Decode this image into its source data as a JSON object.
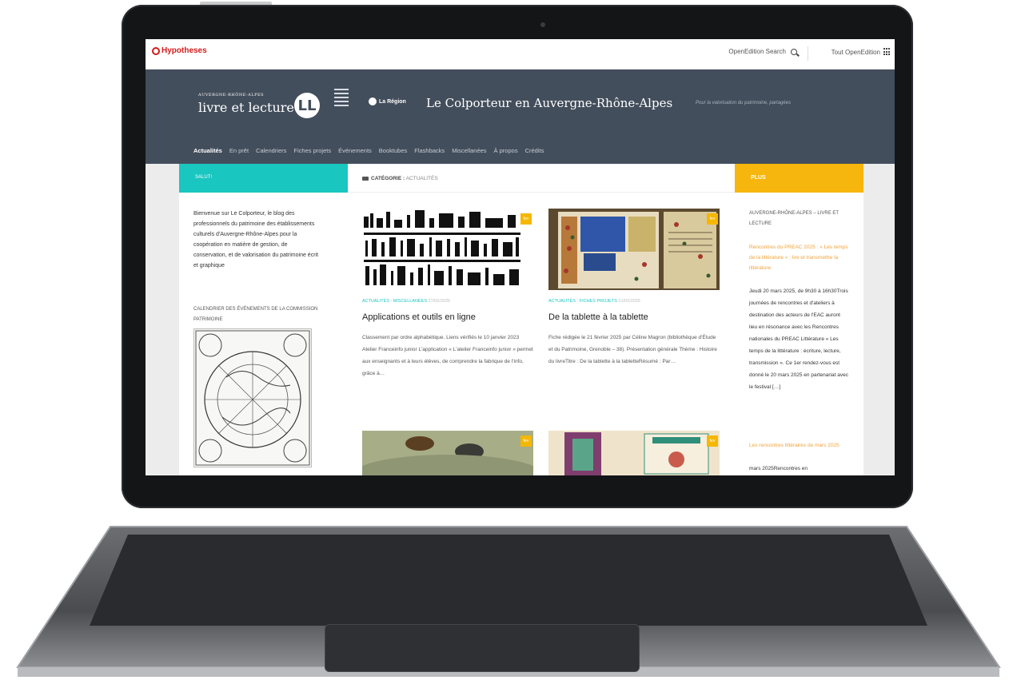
{
  "topbar": {
    "logo_text": "Hypotheses",
    "search_label": "OpenEdition Search",
    "all_label": "Tout OpenEdition"
  },
  "header": {
    "brand_small": "AUVERGNE-RHÔNE-ALPES",
    "brand_big": "livre et lecture",
    "brand_mark": "LL",
    "region_label": "La Région",
    "site_title": "Le Colporteur en Auvergne-Rhône-Alpes",
    "tagline": "Pour la valorisation du patrimoine, partagées"
  },
  "nav": {
    "items": [
      "Actualités",
      "En prêt",
      "Calendriers",
      "Fiches projets",
      "Événements",
      "Booktubes",
      "Flashbacks",
      "Miscellanées",
      "À propos",
      "Crédits"
    ],
    "active": "Actualités"
  },
  "left": {
    "bar_label": "SALUT!",
    "welcome": "Bienvenue sur Le Colporteur, le blog des professionnels du patrimoine des établissements culturels d'Auvergne-Rhône-Alpes pour la coopération en matière de gestion, de conservation, et de valorisation du patrimoine écrit et graphique",
    "calendar_heading": "CALENDRIER DES ÉVÉNEMENTS DE LA COMMISSION PATRIMOINE"
  },
  "main": {
    "category_prefix": "CATÉGORIE :",
    "category": "ACTUALITÉS",
    "posts": [
      {
        "meta": "ACTUALITÉS · MISCELLANÉES",
        "date": "27/02/2025",
        "title": "Applications et outils en ligne",
        "excerpt": "Classement par ordre alphabétique. Liens vérifiés le 10 janvier 2023 Atelier Franceinfo junior L'application « L'atelier Franceinfo junior » permet aux enseignants et à leurs élèves, de comprendre la fabrique de l'info, grâce à…",
        "badge": "fev"
      },
      {
        "meta": "ACTUALITÉS · FICHES PROJETS",
        "date": "21/02/2025",
        "title": "De la tablette à la tablette",
        "excerpt": "Fiche rédigée le 21 février 2025 par Céline Magron (bibliothèque d'Étude et du Patrimoine, Grenoble – 38). Présentation générale Thème : Histoire du livreTitre : De la tablette à la tabletteRésumé : Par…",
        "badge": "fev"
      },
      {
        "badge": "fev"
      },
      {
        "badge": "fev"
      }
    ]
  },
  "right": {
    "bar_label": "PLUS",
    "section_title": "AUVERGNE-RHÔNE-ALPES – LIVRE ET LECTURE",
    "link1": "Rencontres du PREAC 2025 : « Les temps de la littérature » : lire et transmettre la littérature",
    "text1": "Jeudi 20 mars 2025, de 9h30 à 16h30Trois journées de rencontres et d'ateliers à destination des acteurs de l'EAC auront lieu en résonance avec les Rencontres nationales du PREAC Littérature « Les temps de la littérature : écriture, lecture, transmission ». Ce 1er rendez-vous est donné le 20 mars 2025 en partenariat avec le festival […]",
    "link2": "Les rencontres littéraires de mars 2025",
    "text2": "mars 2025Rencontres en"
  },
  "colors": {
    "header_bg": "#434e5c",
    "teal": "#19c6c0",
    "yellow": "#f7b60e",
    "brand_red": "#d21c1c"
  },
  "icons": [
    "search-icon",
    "apps-grid-icon",
    "folder-icon"
  ]
}
